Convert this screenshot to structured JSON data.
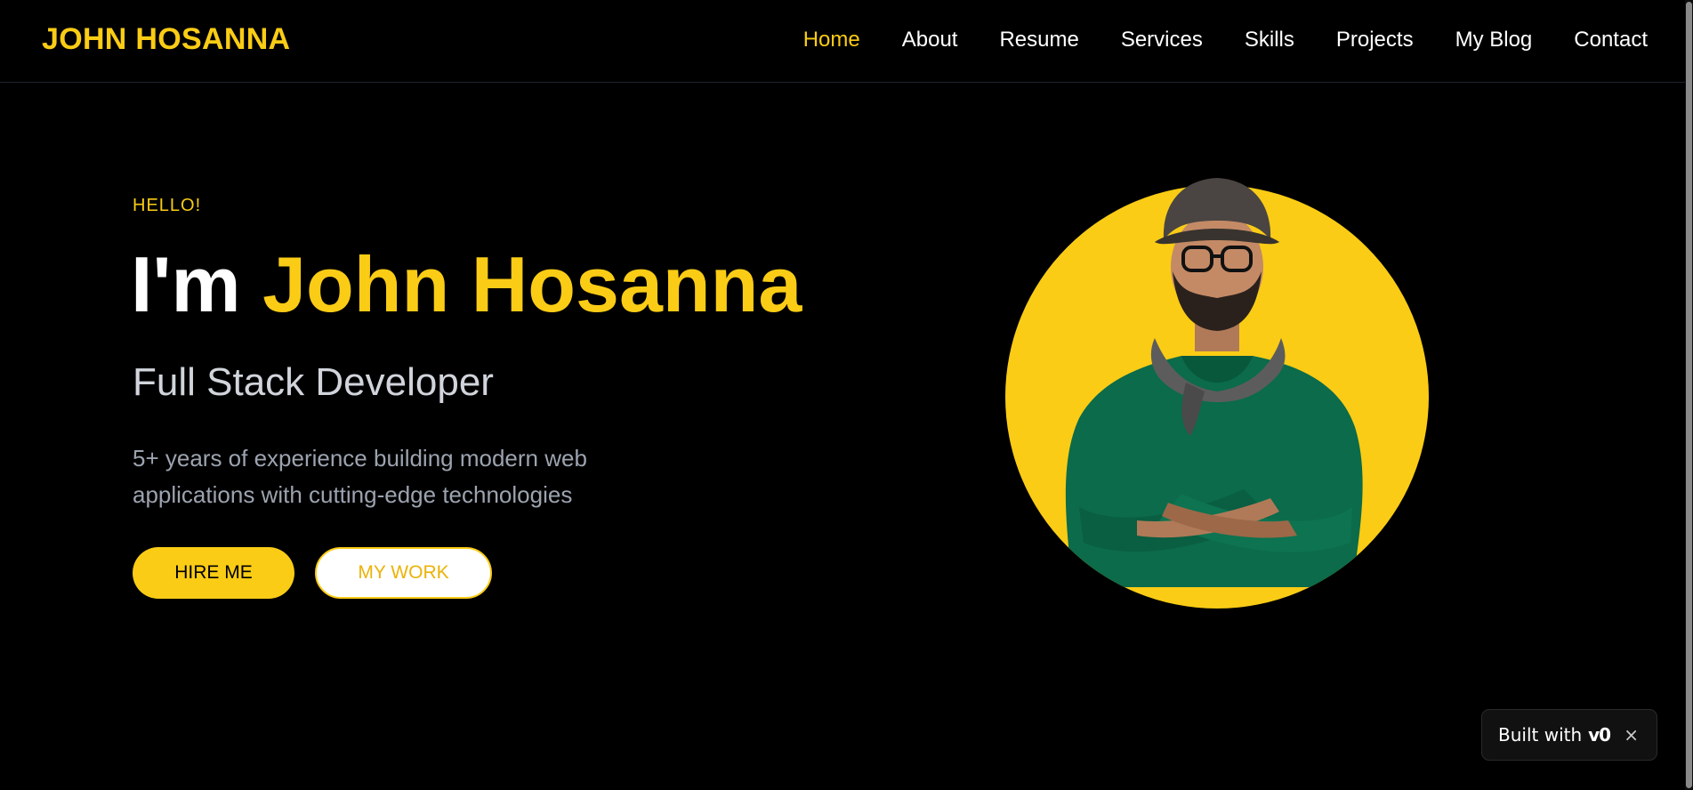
{
  "header": {
    "logo": "JOHN HOSANNA",
    "nav": [
      "Home",
      "About",
      "Resume",
      "Services",
      "Skills",
      "Projects",
      "My Blog",
      "Contact"
    ],
    "active_nav": "Home"
  },
  "hero": {
    "greeting": "HELLO!",
    "headline_prefix": "I'm ",
    "headline_name": "John Hosanna",
    "role": "Full Stack Developer",
    "description": "5+ years of experience building modern web applications with cutting-edge technologies",
    "hire_button": "HIRE ME",
    "work_button": "MY WORK",
    "portrait_icon": "profile-photo"
  },
  "badge": {
    "text": "Built with",
    "brand": "v0",
    "close": "×"
  },
  "colors": {
    "accent": "#facc15",
    "background": "#000000",
    "sweater": "#0b6b4a"
  }
}
